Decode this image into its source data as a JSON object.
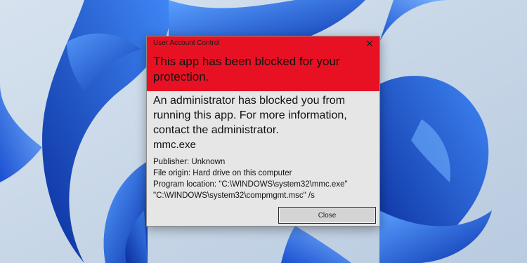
{
  "dialog": {
    "window_title": "User Account Control",
    "heading": "This app has been blocked for your protection.",
    "message": "An administrator has blocked you from running this app. For more information, contact the administrator.",
    "program_name": "mmc.exe",
    "publisher": "Publisher: Unknown",
    "file_origin": "File origin: Hard drive on this computer",
    "program_location": "Program location: \"C:\\WINDOWS\\system32\\mmc.exe\" \"C:\\WINDOWS\\system32\\compmgmt.msc\" /s",
    "close_button_label": "Close",
    "close_icon": "close-icon",
    "header_color": "#e81123"
  },
  "background": {
    "type": "windows-11-bloom-wallpaper",
    "colors": [
      "#c9d7e6",
      "#1d5fe0",
      "#0a3bb8"
    ]
  }
}
